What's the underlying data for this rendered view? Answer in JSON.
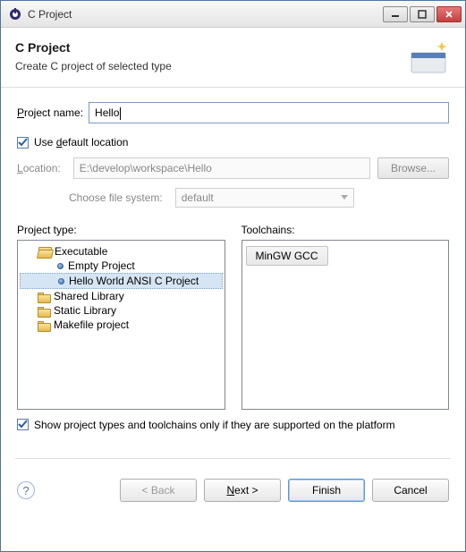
{
  "window": {
    "title": "C Project"
  },
  "header": {
    "title": "C Project",
    "subtitle": "Create C project of selected type"
  },
  "form": {
    "project_name_label_pre": "",
    "project_name_label": "Project name:",
    "project_name_mn": "P",
    "project_name_rest": "roject name:",
    "project_name_value": "Hello",
    "use_default_pre": "Use ",
    "use_default_mn": "d",
    "use_default_rest": "efault location",
    "use_default_checked": true,
    "location_label_mn": "L",
    "location_label_rest": "ocation:",
    "location_value": "E:\\develop\\workspace\\Hello",
    "browse_label": "Browse...",
    "fs_label": "Choose file system:",
    "fs_value": "default"
  },
  "project_type": {
    "label": "Project type:",
    "tree": [
      {
        "kind": "folder-open",
        "label": "Executable",
        "indent": 1
      },
      {
        "kind": "bullet",
        "label": "Empty Project",
        "indent": 2
      },
      {
        "kind": "bullet",
        "label": "Hello World ANSI C Project",
        "indent": 2,
        "selected": true
      },
      {
        "kind": "folder",
        "label": "Shared Library",
        "indent": 1
      },
      {
        "kind": "folder",
        "label": "Static Library",
        "indent": 1
      },
      {
        "kind": "folder",
        "label": "Makefile project",
        "indent": 1
      }
    ]
  },
  "toolchains": {
    "label": "Toolchains:",
    "items": [
      "MinGW GCC"
    ]
  },
  "filter": {
    "checked": true,
    "label": "Show project types and toolchains only if they are supported on the platform"
  },
  "footer": {
    "back": "< Back",
    "next": "Next >",
    "finish": "Finish",
    "cancel": "Cancel"
  }
}
